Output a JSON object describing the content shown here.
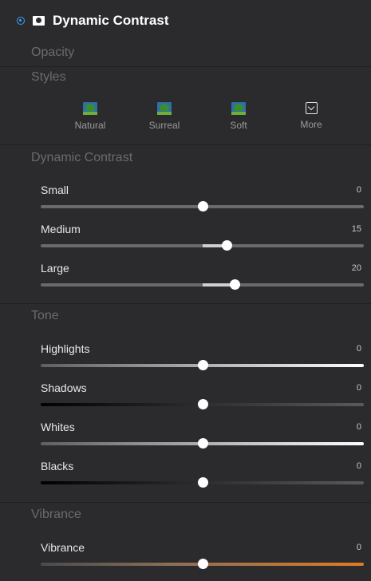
{
  "header": {
    "title": "Dynamic Contrast",
    "enabled": true
  },
  "sections": {
    "opacity": "Opacity",
    "styles": "Styles",
    "dynamic_contrast": "Dynamic Contrast",
    "tone": "Tone",
    "vibrance": "Vibrance"
  },
  "styles": [
    {
      "label": "Natural",
      "icon": "tree-thumbnail-icon"
    },
    {
      "label": "Surreal",
      "icon": "tree-thumbnail-icon"
    },
    {
      "label": "Soft",
      "icon": "tree-thumbnail-icon"
    },
    {
      "label": "More",
      "icon": "chevron-down-box-icon"
    }
  ],
  "dynamic_contrast_sliders": [
    {
      "label": "Small",
      "value": "0",
      "position": 0.5
    },
    {
      "label": "Medium",
      "value": "15",
      "position": 0.575
    },
    {
      "label": "Large",
      "value": "20",
      "position": 0.6
    }
  ],
  "tone_sliders": [
    {
      "label": "Highlights",
      "value": "0",
      "position": 0.5
    },
    {
      "label": "Shadows",
      "value": "0",
      "position": 0.5
    },
    {
      "label": "Whites",
      "value": "0",
      "position": 0.5
    },
    {
      "label": "Blacks",
      "value": "0",
      "position": 0.5
    }
  ],
  "vibrance_sliders": [
    {
      "label": "Vibrance",
      "value": "0",
      "position": 0.5
    }
  ],
  "colors": {
    "accent": "#3aa0ff",
    "panel_bg": "#2b2b2d",
    "vibrance_orange": "#e07a24"
  }
}
